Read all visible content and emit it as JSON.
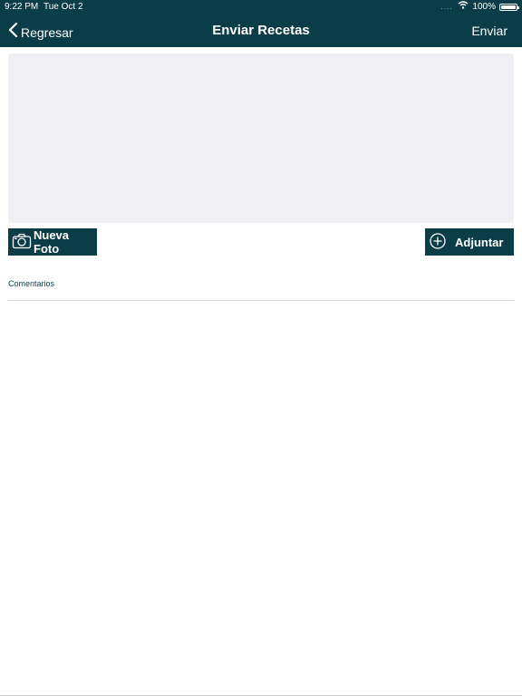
{
  "status_bar": {
    "time": "9:22 PM",
    "date": "Tue Oct 2",
    "signal": "....",
    "battery": "100%",
    "icons": [
      "wifi-icon",
      "battery-icon"
    ]
  },
  "nav": {
    "back_label": "Regresar",
    "title": "Enviar Recetas",
    "send_label": "Enviar"
  },
  "actions": {
    "new_photo_label": "Nueva Foto",
    "attach_label": "Adjuntar"
  },
  "comments": {
    "label": "Comentarios",
    "value": ""
  },
  "colors": {
    "primary": "#0b3d48",
    "photo_area_bg": "#efeff4",
    "divider": "#d6d6d6"
  }
}
